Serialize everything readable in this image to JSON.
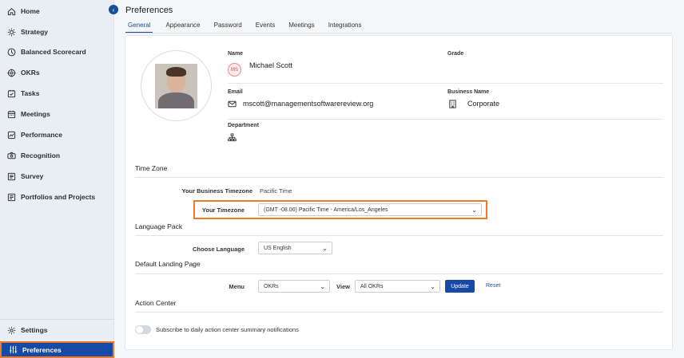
{
  "sidebar": {
    "items": [
      {
        "label": "Home",
        "icon": "home-icon"
      },
      {
        "label": "Strategy",
        "icon": "strategy-icon"
      },
      {
        "label": "Balanced Scorecard",
        "icon": "scorecard-icon"
      },
      {
        "label": "OKRs",
        "icon": "target-icon"
      },
      {
        "label": "Tasks",
        "icon": "tasks-icon"
      },
      {
        "label": "Meetings",
        "icon": "calendar-icon"
      },
      {
        "label": "Performance",
        "icon": "performance-icon"
      },
      {
        "label": "Recognition",
        "icon": "recognition-icon"
      },
      {
        "label": "Survey",
        "icon": "survey-icon"
      },
      {
        "label": "Portfolios and Projects",
        "icon": "portfolio-icon"
      }
    ],
    "bottom_items": [
      {
        "label": "Settings",
        "icon": "gear-icon"
      },
      {
        "label": "Preferences",
        "icon": "sliders-icon",
        "active": true
      }
    ],
    "collapse_icon": "chevron-left-icon"
  },
  "page": {
    "title": "Preferences",
    "tabs": [
      "General",
      "Appearance",
      "Password",
      "Events",
      "Meetings",
      "Integrations"
    ],
    "active_tab": "General"
  },
  "profile": {
    "name_label": "Name",
    "name": "Michael Scott",
    "initials": "MS",
    "grade_label": "Grade",
    "email_label": "Email",
    "email": "mscott@managementsoftwarereview.org",
    "business_name_label": "Business Name",
    "business_name": "Corporate",
    "department_label": "Department"
  },
  "timezone": {
    "section_title": "Time Zone",
    "business_tz_label": "Your Business Timezone",
    "business_tz_value": "Pacific Time",
    "your_tz_label": "Your Timezone",
    "your_tz_value": "(GMT -08.00) Pacific Time - America/Los_Angeles"
  },
  "language": {
    "section_title": "Language Pack",
    "choose_label": "Choose Language",
    "value": "US English"
  },
  "landing": {
    "section_title": "Default Landing Page",
    "menu_label": "Menu",
    "menu_value": "OKRs",
    "view_label": "View",
    "view_value": "All OKRs",
    "update_label": "Update",
    "reset_label": "Reset"
  },
  "action_center": {
    "section_title": "Action Center",
    "toggle_label": "Subscribe to daily action center summary notifications",
    "toggle_on": false
  },
  "colors": {
    "accent": "#154aa6",
    "highlight": "#f07a28",
    "sidebar_bg": "#e9eef5"
  }
}
